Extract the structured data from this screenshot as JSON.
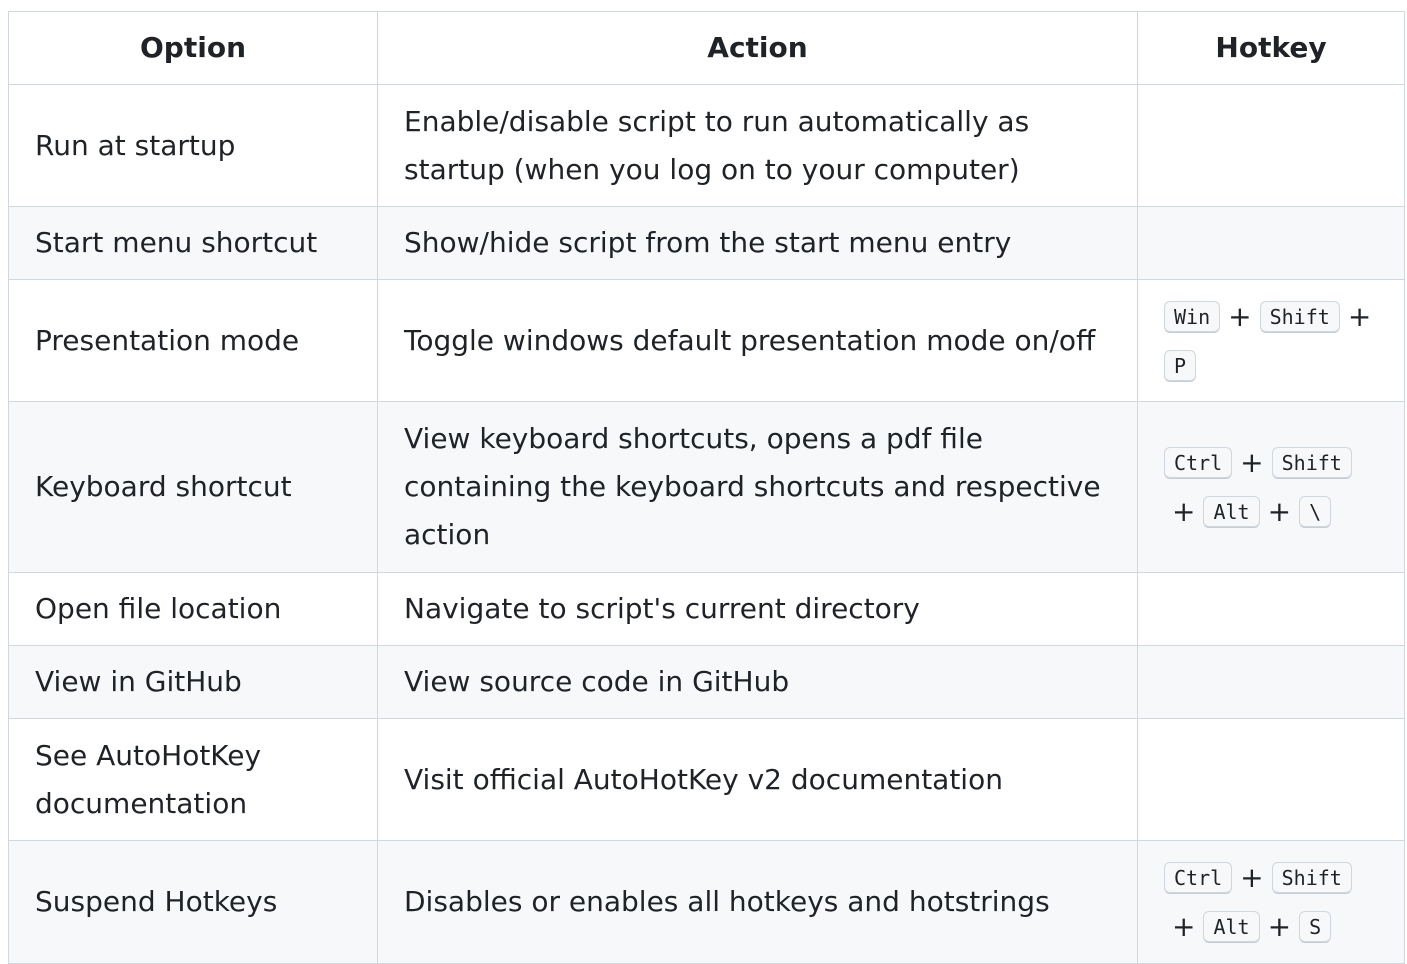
{
  "table": {
    "headers": [
      "Option",
      "Action",
      "Hotkey"
    ],
    "rows": [
      {
        "option": "Run at startup",
        "action": "Enable/disable script to run automatically as startup (when you log on to your computer)",
        "hotkey": []
      },
      {
        "option": "Start menu shortcut",
        "action": "Show/hide script from the start menu entry",
        "hotkey": []
      },
      {
        "option": "Presentation mode",
        "action": "Toggle windows default presentation mode on/off",
        "hotkey": [
          "Win",
          "Shift",
          "P"
        ]
      },
      {
        "option": "Keyboard shortcut",
        "action": "View keyboard shortcuts, opens a pdf file containing the keyboard shortcuts and respective action",
        "hotkey": [
          "Ctrl",
          "Shift",
          "Alt",
          "\\"
        ]
      },
      {
        "option": "Open file location",
        "action": "Navigate to script's current directory",
        "hotkey": []
      },
      {
        "option": "View in GitHub",
        "action": "View source code in GitHub",
        "hotkey": []
      },
      {
        "option": "See AutoHotKey documentation",
        "action": "Visit official AutoHotKey v2 documentation",
        "hotkey": []
      },
      {
        "option": "Suspend Hotkeys",
        "action": "Disables or enables all hotkeys and hotstrings",
        "hotkey": [
          "Ctrl",
          "Shift",
          "Alt",
          "S"
        ]
      }
    ],
    "key_separator": "+"
  },
  "colors": {
    "border": "#d0d7de",
    "stripe": "#f6f8fa",
    "text": "#1f2328"
  }
}
